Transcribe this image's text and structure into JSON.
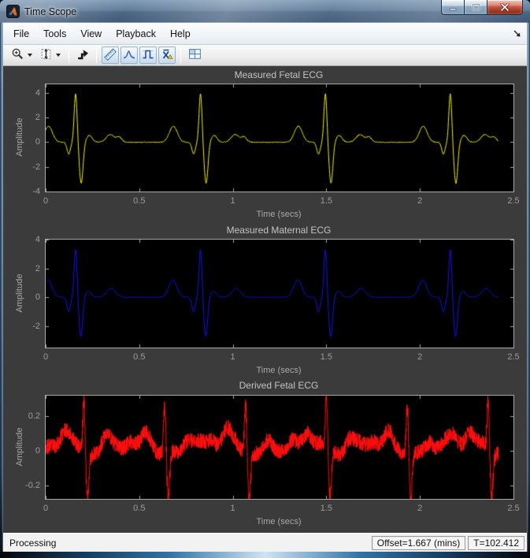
{
  "window": {
    "title": "Time Scope",
    "app_icon": "matlab-logo",
    "controls": [
      {
        "name": "minimize",
        "glyph": "minimize-icon"
      },
      {
        "name": "maximize",
        "glyph": "maximize-icon"
      },
      {
        "name": "close",
        "glyph": "close-icon"
      }
    ]
  },
  "menubar": {
    "items": [
      "File",
      "Tools",
      "View",
      "Playback",
      "Help"
    ],
    "dock_icon": "dock-arrow-icon"
  },
  "toolbar": {
    "buttons": [
      {
        "name": "zoom-in",
        "icon": "zoom-in-icon",
        "has_dropdown": true,
        "framed": false
      },
      {
        "name": "scale-axes",
        "icon": "scale-axes-icon",
        "has_dropdown": true,
        "framed": false
      },
      {
        "separator": true
      },
      {
        "name": "step-forward",
        "icon": "step-forward-icon",
        "has_dropdown": false,
        "framed": false
      },
      {
        "separator": true
      },
      {
        "name": "cursor-measurements",
        "icon": "ruler-icon",
        "has_dropdown": false,
        "framed": true
      },
      {
        "name": "peak-finder",
        "icon": "peak-finder-icon",
        "has_dropdown": false,
        "framed": true
      },
      {
        "name": "bilevel-measurements",
        "icon": "bilevel-icon",
        "has_dropdown": false,
        "framed": true
      },
      {
        "name": "signal-statistics",
        "icon": "signal-statistics-icon",
        "has_dropdown": false,
        "framed": true
      },
      {
        "separator": true
      },
      {
        "name": "layout",
        "icon": "layout-grid-icon",
        "has_dropdown": false,
        "framed": false
      }
    ]
  },
  "statusbar": {
    "left": "Processing",
    "offset": "Offset=1.667 (mins)",
    "time": "T=102.412"
  },
  "colors": {
    "figure_background": "#3b3b3b",
    "axes_background": "#000000",
    "axis_line": "#a9a9a9",
    "tick_label": "#9c9c9c",
    "title_text": "#c3c3c3",
    "trace_yellow": "#f0f000",
    "trace_blue": "#1414f0",
    "trace_red": "#ff0f0f"
  },
  "chart_data": [
    {
      "type": "line",
      "title": "Measured Fetal ECG",
      "xlabel": "Time (secs)",
      "ylabel": "Amplitude",
      "xlim": [
        0,
        2.5
      ],
      "ylim": [
        -4,
        4.7
      ],
      "xticks": {
        "values": [
          0,
          0.5,
          1,
          1.5,
          2,
          2.5
        ],
        "labels": [
          "0",
          "0.5",
          "1",
          "1.5",
          "2",
          "2.5"
        ]
      },
      "yticks": {
        "values": [
          4,
          2,
          0,
          -2,
          -4
        ],
        "labels": [
          "4",
          "2",
          "0",
          "-2",
          "-4"
        ]
      },
      "line_color": "#f0f000",
      "grid": false,
      "legend": null,
      "signal": {
        "t_end": 2.42,
        "samples": 1500,
        "noise": 0.035,
        "seed": 7,
        "wobble": [],
        "beat_trains": [
          {
            "beat_times": [
              -0.5075,
              0.16,
              0.8275,
              1.495,
              2.1625
            ],
            "components": [
              {
                "center": -0.145,
                "amp": 1.3,
                "width": 0.03
              },
              {
                "center": -0.037,
                "amp": -0.95,
                "width": 0.013
              },
              {
                "center": 0.0,
                "amp": 3.95,
                "width": 0.011
              },
              {
                "center": 0.03,
                "amp": -3.35,
                "width": 0.014
              },
              {
                "center": 0.073,
                "amp": 0.55,
                "width": 0.022
              },
              {
                "center": 0.185,
                "amp": 0.62,
                "width": 0.03
              },
              {
                "center": 0.233,
                "amp": 0.4,
                "width": 0.02
              }
            ]
          }
        ]
      }
    },
    {
      "type": "line",
      "title": "Measured Maternal ECG",
      "xlabel": "Time (secs)",
      "ylabel": "Amplitude",
      "xlim": [
        0,
        2.5
      ],
      "ylim": [
        -3.5,
        4
      ],
      "xticks": {
        "values": [
          0,
          0.5,
          1,
          1.5,
          2,
          2.5
        ],
        "labels": [
          "0",
          "0.5",
          "1",
          "1.5",
          "2",
          "2.5"
        ]
      },
      "yticks": {
        "values": [
          4,
          2,
          0,
          -2
        ],
        "labels": [
          "4",
          "2",
          "0",
          "-2"
        ]
      },
      "line_color": "#1414f0",
      "grid": false,
      "legend": null,
      "signal": {
        "t_end": 2.42,
        "samples": 1300,
        "noise": 0.012,
        "seed": 11,
        "wobble": [],
        "beat_trains": [
          {
            "beat_times": [
              -0.5075,
              0.16,
              0.8275,
              1.495,
              2.1625
            ],
            "components": [
              {
                "center": -0.148,
                "amp": 1.2,
                "width": 0.03
              },
              {
                "center": -0.037,
                "amp": -1.0,
                "width": 0.013
              },
              {
                "center": 0.0,
                "amp": 3.35,
                "width": 0.011
              },
              {
                "center": 0.028,
                "amp": -2.75,
                "width": 0.014
              },
              {
                "center": 0.068,
                "amp": 0.4,
                "width": 0.022
              },
              {
                "center": 0.19,
                "amp": 0.6,
                "width": 0.033
              }
            ]
          }
        ]
      }
    },
    {
      "type": "line",
      "title": "Derived Fetal ECG",
      "xlabel": "Time (secs)",
      "ylabel": "Amplitude",
      "xlim": [
        0,
        2.5
      ],
      "ylim": [
        -0.28,
        0.32
      ],
      "xticks": {
        "values": [
          0,
          0.5,
          1,
          1.5,
          2,
          2.5
        ],
        "labels": [
          "0",
          "0.5",
          "1",
          "1.5",
          "2",
          "2.5"
        ]
      },
      "yticks": {
        "values": [
          0.2,
          0,
          -0.2
        ],
        "labels": [
          "0.2",
          "0",
          "-0.2"
        ]
      },
      "line_color": "#ff0f0f",
      "grid": false,
      "legend": null,
      "signal": {
        "t_end": 2.42,
        "samples": 2600,
        "noise": 0.045,
        "seed": 23,
        "wobble": [
          {
            "amp": 0.016,
            "freq": 2.3,
            "phase": 1.2
          },
          {
            "amp": 0.01,
            "freq": 6.1,
            "phase": 0.5
          }
        ],
        "beat_trains": [
          {
            "beat_times": [
              0.205,
              0.637,
              1.069,
              1.501,
              1.933,
              2.365
            ],
            "components": [
              {
                "center": -0.1,
                "amp": 0.095,
                "width": 0.035
              },
              {
                "center": 0.0,
                "amp": 0.3,
                "width": 0.0085
              },
              {
                "center": 0.018,
                "amp": -0.27,
                "width": 0.011
              },
              {
                "center": 0.12,
                "amp": 0.06,
                "width": 0.03
              },
              {
                "center": 0.25,
                "amp": 0.045,
                "width": 0.03
              }
            ]
          },
          {
            "beat_times": [
              0.16,
              0.8275,
              1.495,
              2.1625
            ],
            "components": [
              {
                "center": -0.02,
                "amp": 0.05,
                "width": 0.045
              },
              {
                "center": 0.17,
                "amp": 0.04,
                "width": 0.05
              }
            ]
          }
        ]
      }
    }
  ]
}
